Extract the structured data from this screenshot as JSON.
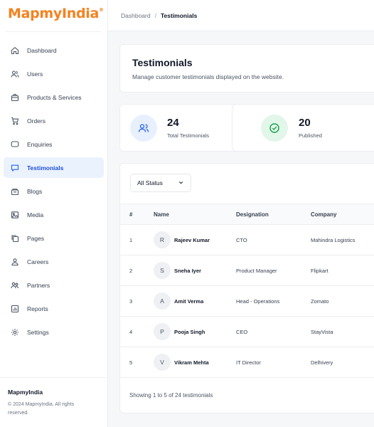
{
  "brand": {
    "logo_text": "MapmyIndia",
    "registered_mark": "®"
  },
  "sidebar": {
    "items": [
      {
        "label": "Dashboard",
        "icon": "home-icon"
      },
      {
        "label": "Users",
        "icon": "users-icon"
      },
      {
        "label": "Products & Services",
        "icon": "box-icon"
      },
      {
        "label": "Orders",
        "icon": "cart-icon"
      },
      {
        "label": "Enquiries",
        "icon": "chat-icon"
      },
      {
        "label": "Testimonials",
        "icon": "message-icon",
        "active": true
      },
      {
        "label": "Blogs",
        "icon": "layers-icon"
      },
      {
        "label": "Media",
        "icon": "image-icon"
      },
      {
        "label": "Pages",
        "icon": "copy-icon"
      },
      {
        "label": "Careers",
        "icon": "person-icon"
      },
      {
        "label": "Partners",
        "icon": "partners-icon"
      },
      {
        "label": "Reports",
        "icon": "report-icon"
      },
      {
        "label": "Settings",
        "icon": "gear-icon"
      }
    ],
    "footer": {
      "brand": "MapmyIndia",
      "copyright": "© 2024 MapmyIndia. All rights reserved."
    }
  },
  "breadcrumb": {
    "parent": "Dashboard",
    "separator": "/",
    "current": "Testimonials"
  },
  "page": {
    "title": "Testimonials",
    "subtitle": "Manage customer testimonials displayed on the website."
  },
  "stats": [
    {
      "value": "24",
      "label": "Total Testimonials",
      "icon": "users-icon",
      "color": "#2563eb",
      "bg": "#e8f0fe"
    },
    {
      "value": "20",
      "label": "Published",
      "icon": "check-circle-icon",
      "color": "#16a34a",
      "bg": "#e3f6ea"
    }
  ],
  "filter": {
    "selected": "All Status"
  },
  "table": {
    "columns": [
      "#",
      "Name",
      "Designation",
      "Company"
    ],
    "rows": [
      {
        "num": "1",
        "initial": "R",
        "name": "Rajeev Kumar",
        "designation": "CTO",
        "company": "Mahindra Logistics"
      },
      {
        "num": "2",
        "initial": "S",
        "name": "Sneha Iyer",
        "designation": "Product Manager",
        "company": "Flipkart"
      },
      {
        "num": "3",
        "initial": "A",
        "name": "Amit Verma",
        "designation": "Head - Operations",
        "company": "Zomato"
      },
      {
        "num": "4",
        "initial": "P",
        "name": "Pooja Singh",
        "designation": "CEO",
        "company": "StayVista"
      },
      {
        "num": "5",
        "initial": "V",
        "name": "Vikram Mehta",
        "designation": "IT Director",
        "company": "Delhivery"
      }
    ],
    "footer": "Showing 1 to 5 of 24 testimonials"
  }
}
